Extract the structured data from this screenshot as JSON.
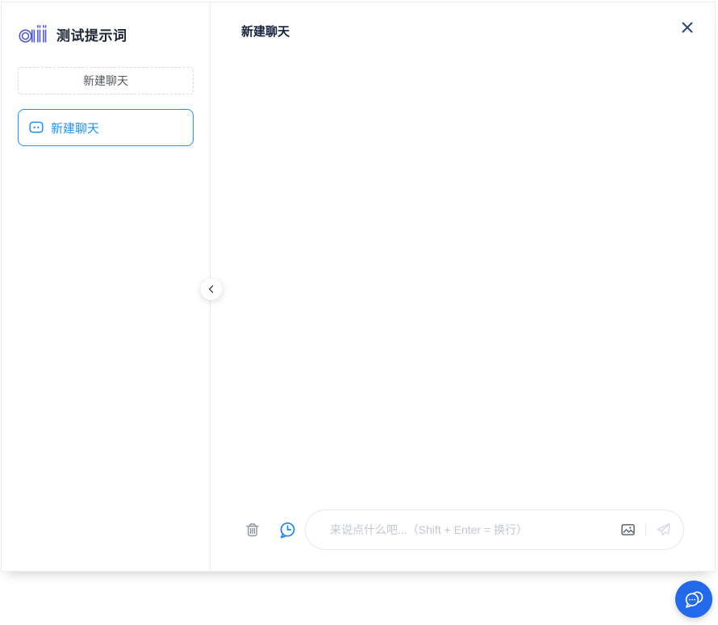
{
  "app": {
    "title": "测试提示词"
  },
  "sidebar": {
    "new_chat_button_label": "新建聊天",
    "chats": [
      {
        "label": "新建聊天",
        "active": true
      }
    ]
  },
  "chat": {
    "title": "新建聊天",
    "composer": {
      "placeholder": "来说点什么吧...（Shift + Enter = 换行）"
    }
  },
  "icons": {
    "logo": "ai-logo-icon",
    "active_chat": "chat-bubble-icon",
    "collapse": "chevron-left-icon",
    "close": "close-icon",
    "clear": "trash-icon",
    "history": "chat-history-clock-icon",
    "image": "image-icon",
    "send": "paper-plane-icon",
    "floating": "chat-bubbles-icon"
  },
  "colors": {
    "accent_blue": "#1e90ff",
    "logo_indigo": "#4b55e2",
    "close_navy": "#2b4a77",
    "float_blue": "#2269ec",
    "placeholder_gray": "#c2c7cf"
  }
}
